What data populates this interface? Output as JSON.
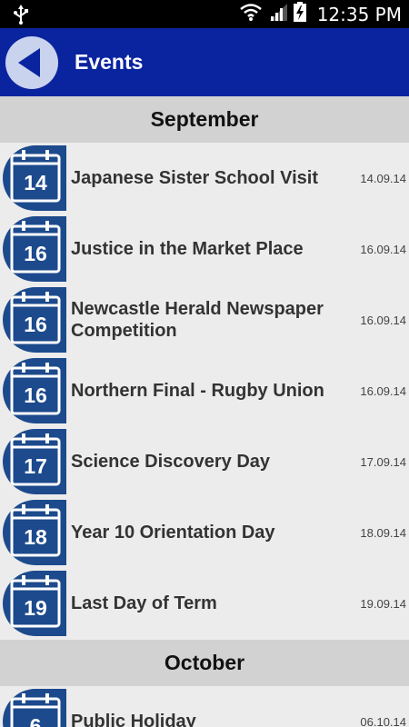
{
  "status_bar": {
    "time": "12:35 PM"
  },
  "app_bar": {
    "title": "Events"
  },
  "sections": [
    {
      "month": "September",
      "events": [
        {
          "day": "14",
          "title": "Japanese Sister School Visit",
          "date": "14.09.14"
        },
        {
          "day": "16",
          "title": "Justice in the Market Place",
          "date": "16.09.14"
        },
        {
          "day": "16",
          "title": "Newcastle Herald Newspaper Competition",
          "date": "16.09.14"
        },
        {
          "day": "16",
          "title": "Northern Final - Rugby Union",
          "date": "16.09.14"
        },
        {
          "day": "17",
          "title": "Science Discovery Day",
          "date": "17.09.14"
        },
        {
          "day": "18",
          "title": "Year 10 Orientation Day",
          "date": "18.09.14"
        },
        {
          "day": "19",
          "title": "Last Day of Term",
          "date": "19.09.14"
        }
      ]
    },
    {
      "month": "October",
      "events": [
        {
          "day": "6",
          "title": "Public Holiday",
          "date": "06.10.14"
        }
      ]
    }
  ],
  "colors": {
    "app_bar": "#0a24a0",
    "calendar_icon": "#1c4a8c",
    "back_button": "#c9d3ee"
  },
  "icons": {
    "back": "back-arrow-icon",
    "calendar": "calendar-icon",
    "usb": "usb-icon",
    "wifi": "wifi-icon",
    "signal": "signal-icon",
    "battery": "battery-charging-icon"
  }
}
